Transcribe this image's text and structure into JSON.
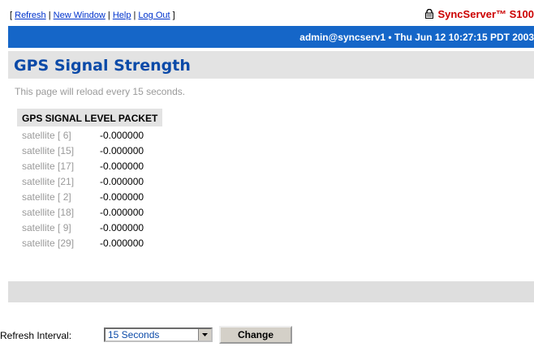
{
  "topbar": {
    "bracket_open": "[",
    "bracket_close": "]",
    "separator": "|",
    "links": [
      "Refresh",
      "New Window",
      "Help",
      "Log Out"
    ],
    "brand_sync": "Sync",
    "brand_rest": "Server™ S100"
  },
  "userbar": {
    "user": "admin@syncserv1",
    "bullet": "•",
    "datetime": "Thu Jun 12 10:27:15 PDT 2003"
  },
  "page": {
    "title": "GPS Signal Strength",
    "reload_note": "This page will reload every 15 seconds."
  },
  "table": {
    "header": "GPS SIGNAL LEVEL PACKET",
    "rows": [
      {
        "satellite": "satellite [ 6]",
        "level": "-0.000000"
      },
      {
        "satellite": "satellite [15]",
        "level": "-0.000000"
      },
      {
        "satellite": "satellite [17]",
        "level": "-0.000000"
      },
      {
        "satellite": "satellite [21]",
        "level": "-0.000000"
      },
      {
        "satellite": "satellite [ 2]",
        "level": "-0.000000"
      },
      {
        "satellite": "satellite [18]",
        "level": "-0.000000"
      },
      {
        "satellite": "satellite [ 9]",
        "level": "-0.000000"
      },
      {
        "satellite": "satellite [29]",
        "level": "-0.000000"
      }
    ]
  },
  "refresh": {
    "label": "Refresh Interval:",
    "selected": "15 Seconds",
    "change_label": "Change"
  },
  "icons": {
    "lock": "lock-icon",
    "dropdown": "chevron-down-icon"
  },
  "colors": {
    "blue_bar": "#1566c8",
    "title": "#0b4aa8",
    "brand": "#cc0000",
    "link": "#0033cc"
  }
}
